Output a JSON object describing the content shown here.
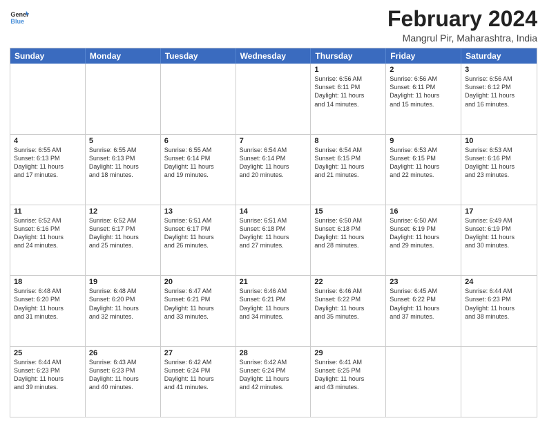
{
  "logo": {
    "line1": "General",
    "line2": "Blue"
  },
  "header": {
    "month_year": "February 2024",
    "location": "Mangrul Pir, Maharashtra, India"
  },
  "days_of_week": [
    "Sunday",
    "Monday",
    "Tuesday",
    "Wednesday",
    "Thursday",
    "Friday",
    "Saturday"
  ],
  "weeks": [
    [
      {
        "date": "",
        "info": ""
      },
      {
        "date": "",
        "info": ""
      },
      {
        "date": "",
        "info": ""
      },
      {
        "date": "",
        "info": ""
      },
      {
        "date": "1",
        "info": "Sunrise: 6:56 AM\nSunset: 6:11 PM\nDaylight: 11 hours\nand 14 minutes."
      },
      {
        "date": "2",
        "info": "Sunrise: 6:56 AM\nSunset: 6:11 PM\nDaylight: 11 hours\nand 15 minutes."
      },
      {
        "date": "3",
        "info": "Sunrise: 6:56 AM\nSunset: 6:12 PM\nDaylight: 11 hours\nand 16 minutes."
      }
    ],
    [
      {
        "date": "4",
        "info": "Sunrise: 6:55 AM\nSunset: 6:13 PM\nDaylight: 11 hours\nand 17 minutes."
      },
      {
        "date": "5",
        "info": "Sunrise: 6:55 AM\nSunset: 6:13 PM\nDaylight: 11 hours\nand 18 minutes."
      },
      {
        "date": "6",
        "info": "Sunrise: 6:55 AM\nSunset: 6:14 PM\nDaylight: 11 hours\nand 19 minutes."
      },
      {
        "date": "7",
        "info": "Sunrise: 6:54 AM\nSunset: 6:14 PM\nDaylight: 11 hours\nand 20 minutes."
      },
      {
        "date": "8",
        "info": "Sunrise: 6:54 AM\nSunset: 6:15 PM\nDaylight: 11 hours\nand 21 minutes."
      },
      {
        "date": "9",
        "info": "Sunrise: 6:53 AM\nSunset: 6:15 PM\nDaylight: 11 hours\nand 22 minutes."
      },
      {
        "date": "10",
        "info": "Sunrise: 6:53 AM\nSunset: 6:16 PM\nDaylight: 11 hours\nand 23 minutes."
      }
    ],
    [
      {
        "date": "11",
        "info": "Sunrise: 6:52 AM\nSunset: 6:16 PM\nDaylight: 11 hours\nand 24 minutes."
      },
      {
        "date": "12",
        "info": "Sunrise: 6:52 AM\nSunset: 6:17 PM\nDaylight: 11 hours\nand 25 minutes."
      },
      {
        "date": "13",
        "info": "Sunrise: 6:51 AM\nSunset: 6:17 PM\nDaylight: 11 hours\nand 26 minutes."
      },
      {
        "date": "14",
        "info": "Sunrise: 6:51 AM\nSunset: 6:18 PM\nDaylight: 11 hours\nand 27 minutes."
      },
      {
        "date": "15",
        "info": "Sunrise: 6:50 AM\nSunset: 6:18 PM\nDaylight: 11 hours\nand 28 minutes."
      },
      {
        "date": "16",
        "info": "Sunrise: 6:50 AM\nSunset: 6:19 PM\nDaylight: 11 hours\nand 29 minutes."
      },
      {
        "date": "17",
        "info": "Sunrise: 6:49 AM\nSunset: 6:19 PM\nDaylight: 11 hours\nand 30 minutes."
      }
    ],
    [
      {
        "date": "18",
        "info": "Sunrise: 6:48 AM\nSunset: 6:20 PM\nDaylight: 11 hours\nand 31 minutes."
      },
      {
        "date": "19",
        "info": "Sunrise: 6:48 AM\nSunset: 6:20 PM\nDaylight: 11 hours\nand 32 minutes."
      },
      {
        "date": "20",
        "info": "Sunrise: 6:47 AM\nSunset: 6:21 PM\nDaylight: 11 hours\nand 33 minutes."
      },
      {
        "date": "21",
        "info": "Sunrise: 6:46 AM\nSunset: 6:21 PM\nDaylight: 11 hours\nand 34 minutes."
      },
      {
        "date": "22",
        "info": "Sunrise: 6:46 AM\nSunset: 6:22 PM\nDaylight: 11 hours\nand 35 minutes."
      },
      {
        "date": "23",
        "info": "Sunrise: 6:45 AM\nSunset: 6:22 PM\nDaylight: 11 hours\nand 37 minutes."
      },
      {
        "date": "24",
        "info": "Sunrise: 6:44 AM\nSunset: 6:23 PM\nDaylight: 11 hours\nand 38 minutes."
      }
    ],
    [
      {
        "date": "25",
        "info": "Sunrise: 6:44 AM\nSunset: 6:23 PM\nDaylight: 11 hours\nand 39 minutes."
      },
      {
        "date": "26",
        "info": "Sunrise: 6:43 AM\nSunset: 6:23 PM\nDaylight: 11 hours\nand 40 minutes."
      },
      {
        "date": "27",
        "info": "Sunrise: 6:42 AM\nSunset: 6:24 PM\nDaylight: 11 hours\nand 41 minutes."
      },
      {
        "date": "28",
        "info": "Sunrise: 6:42 AM\nSunset: 6:24 PM\nDaylight: 11 hours\nand 42 minutes."
      },
      {
        "date": "29",
        "info": "Sunrise: 6:41 AM\nSunset: 6:25 PM\nDaylight: 11 hours\nand 43 minutes."
      },
      {
        "date": "",
        "info": ""
      },
      {
        "date": "",
        "info": ""
      }
    ]
  ]
}
